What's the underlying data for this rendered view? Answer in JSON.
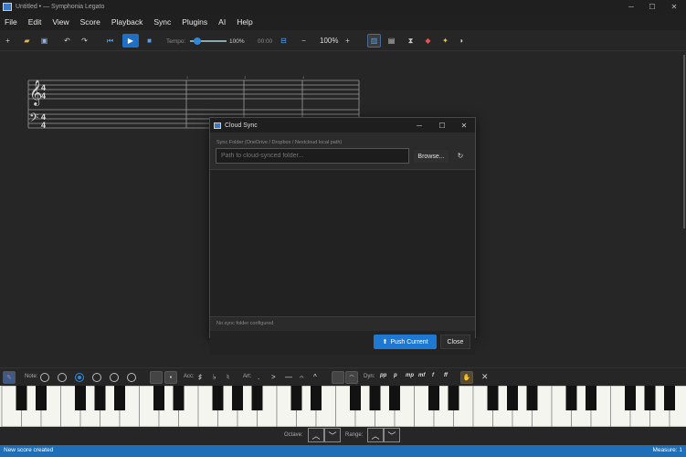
{
  "window": {
    "title": "Untitled • — Symphonia Legato"
  },
  "menu": [
    "File",
    "Edit",
    "View",
    "Score",
    "Playback",
    "Sync",
    "Plugins",
    "AI",
    "Help"
  ],
  "toolbar": {
    "tempo_label": "Tempo:",
    "tempo_value": "100%",
    "time": "00:00",
    "zoom": "100%",
    "tempo_level": 0.1
  },
  "score": {
    "measure_numbers": [
      "2",
      "3",
      "4"
    ],
    "time_signature": {
      "top": "4",
      "bottom": "4"
    }
  },
  "dialog": {
    "title": "Cloud Sync",
    "hint": "Sync Folder (OneDrive / Dropbox / Nextcloud local path)",
    "path_placeholder": "Path to cloud-synced folder...",
    "path_value": "",
    "browse_label": "Browse...",
    "status": "No sync folder configured",
    "push_label": "Push Current",
    "close_label": "Close"
  },
  "palette": {
    "note_label": "Note:",
    "acc_label": "Acc:",
    "art_label": "Art:",
    "dyn_label": "Dyn:",
    "dynamics": [
      "pp",
      "p",
      "mp",
      "mf",
      "f",
      "ff"
    ],
    "accidentals": [
      "♯",
      "♭",
      "♮"
    ],
    "articulations": [
      ".",
      ">",
      "—",
      "𝄐",
      "^"
    ]
  },
  "keyboard": {
    "octave_label": "Octave:",
    "range_label": "Range:"
  },
  "status": {
    "left": "New score created",
    "right": "Measure: 1"
  }
}
